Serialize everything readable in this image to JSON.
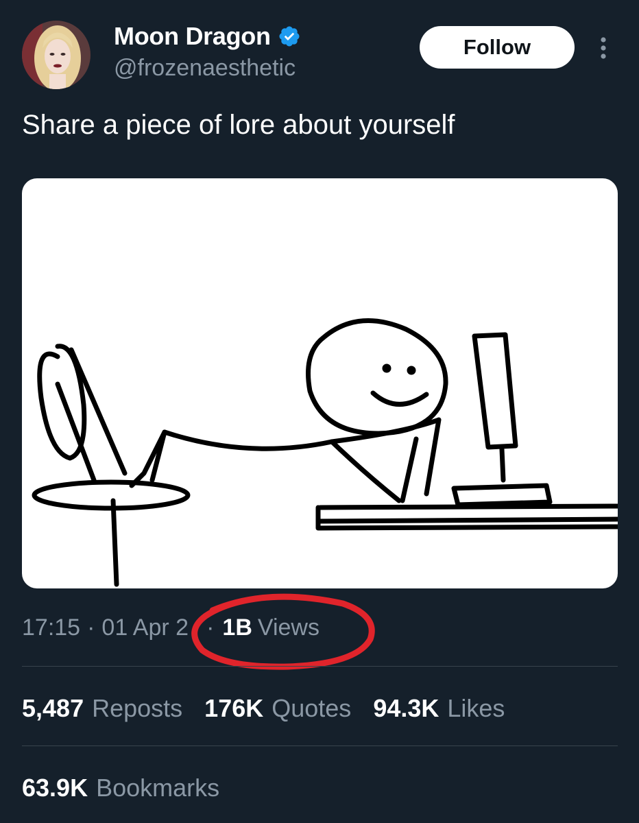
{
  "author": {
    "display_name": "Moon Dragon",
    "handle": "@frozenaesthetic",
    "verified": true
  },
  "header": {
    "follow_label": "Follow"
  },
  "tweet": {
    "text": "Share a piece of lore about yourself"
  },
  "meta": {
    "time": "17:15",
    "sep1": "·",
    "date": "01 Apr 2",
    "sep2": "·",
    "views_count": "1B",
    "views_label": "Views"
  },
  "stats": {
    "reposts_count": "5,487",
    "reposts_label": "Reposts",
    "quotes_count": "176K",
    "quotes_label": "Quotes",
    "likes_count": "94.3K",
    "likes_label": "Likes",
    "bookmarks_count": "63.9K",
    "bookmarks_label": "Bookmarks"
  },
  "colors": {
    "background": "#15202b",
    "secondary_text": "#8b98a5",
    "verified_blue": "#1d9bf0",
    "highlight_red": "#e0242b",
    "divider": "#38444d"
  },
  "icons": [
    "verified-badge-icon",
    "more-options-icon"
  ]
}
